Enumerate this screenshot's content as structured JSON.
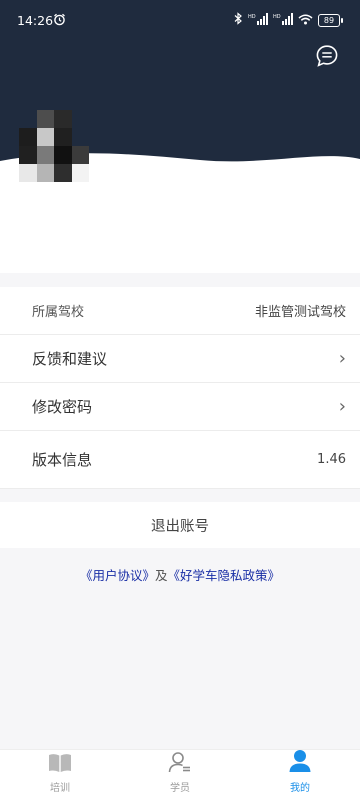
{
  "status_bar": {
    "time": "14:26",
    "battery": "89",
    "icons": [
      "alarm-icon",
      "bluetooth-icon",
      "signal-icon",
      "signal-icon",
      "wifi-icon",
      "battery-icon"
    ]
  },
  "header": {
    "background": "#1f2b3e",
    "message_icon": "chat-bubble-icon"
  },
  "settings": {
    "school_label": "所属驾校",
    "school_value": "非监管测试驾校",
    "feedback_label": "反馈和建议",
    "password_label": "修改密码",
    "version_label": "版本信息",
    "version_value": "1.46",
    "chevron": "›"
  },
  "logout_label": "退出账号",
  "agreements": {
    "user_agreement": "《用户协议》",
    "connector": "及",
    "privacy_policy": "《好学车隐私政策》",
    "link_color": "#1a2fa6"
  },
  "tabbar": {
    "tabs": [
      {
        "label": "培训",
        "icon": "book-icon",
        "active": false
      },
      {
        "label": "学员",
        "icon": "student-icon",
        "active": false
      },
      {
        "label": "我的",
        "icon": "person-icon",
        "active": true
      }
    ],
    "active_color": "#1a8fe8",
    "inactive_color": "#9a9a9a"
  }
}
